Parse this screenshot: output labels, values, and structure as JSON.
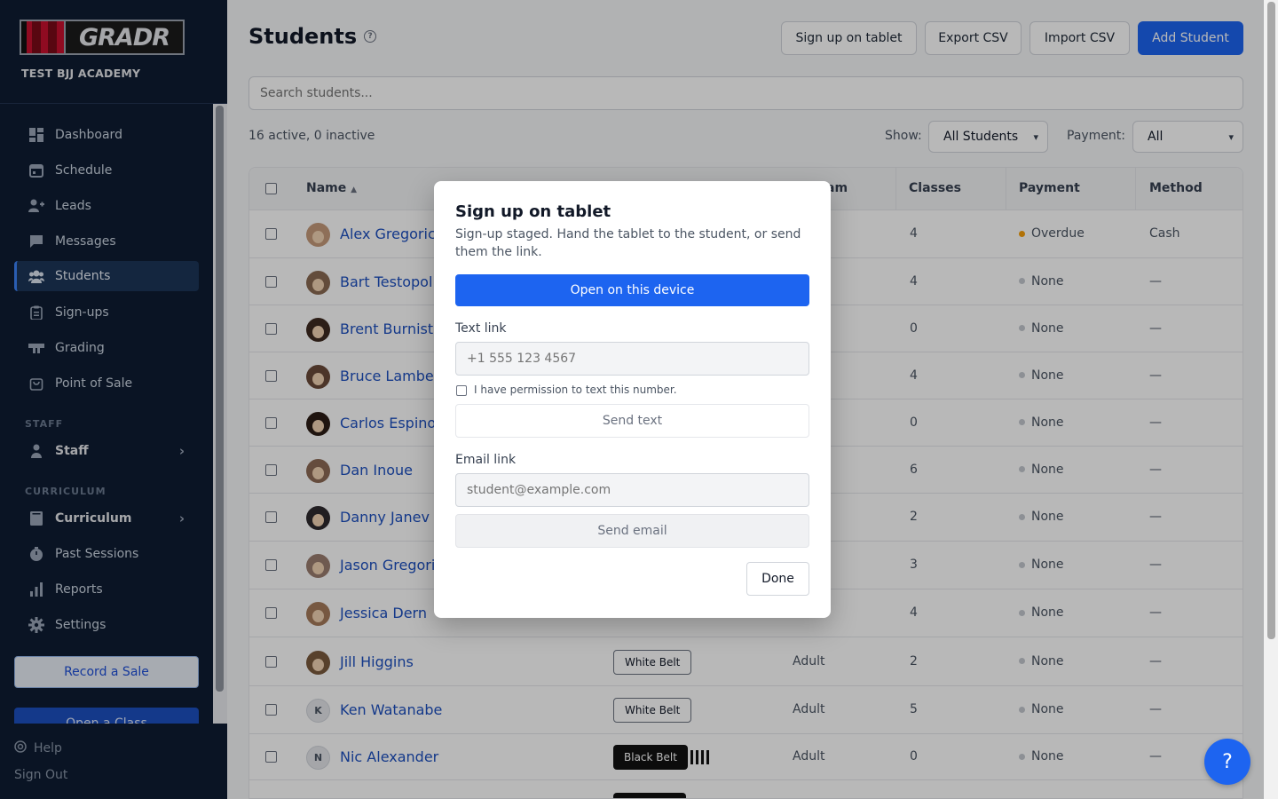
{
  "sidebar": {
    "logo_text": "GRADR",
    "academy": "TEST BJJ ACADEMY",
    "nav": [
      {
        "label": "Dashboard",
        "icon": "dashboard-icon"
      },
      {
        "label": "Schedule",
        "icon": "calendar-icon"
      },
      {
        "label": "Leads",
        "icon": "user-plus-icon"
      },
      {
        "label": "Messages",
        "icon": "chat-icon"
      },
      {
        "label": "Students",
        "icon": "users-icon",
        "active": true
      },
      {
        "label": "Sign-ups",
        "icon": "clipboard-icon"
      },
      {
        "label": "Grading",
        "icon": "belt-icon"
      },
      {
        "label": "Point of Sale",
        "icon": "shopping-bag-icon"
      }
    ],
    "staff_section": "STAFF",
    "staff_item": "Staff",
    "curriculum_section": "CURRICULUM",
    "curriculum_item": "Curriculum",
    "nav2": [
      {
        "label": "Past Sessions",
        "icon": "clock-icon"
      },
      {
        "label": "Reports",
        "icon": "bar-chart-icon"
      },
      {
        "label": "Settings",
        "icon": "gear-icon"
      }
    ],
    "record_sale": "Record a Sale",
    "open_class": "Open a Class",
    "help": "Help",
    "sign_out": "Sign Out"
  },
  "header": {
    "title": "Students",
    "buttons": {
      "signup_tablet": "Sign up on tablet",
      "export_csv": "Export CSV",
      "import_csv": "Import CSV",
      "add_student": "Add Student"
    }
  },
  "search": {
    "placeholder": "Search students..."
  },
  "filters": {
    "counts": "16 active, 0 inactive",
    "show_label": "Show:",
    "show_value": "All Students",
    "payment_label": "Payment:",
    "payment_value": "All"
  },
  "table": {
    "columns": {
      "name": "Name",
      "sort_indicator": "▲",
      "program_fragment": "am",
      "classes": "Classes",
      "payment": "Payment",
      "method": "Method"
    },
    "rows": [
      {
        "name": "Alex Gregoric",
        "belt": "",
        "stripes": 0,
        "program": "",
        "classes": "4",
        "payment": "Overdue",
        "method": "Cash",
        "status": "overdue"
      },
      {
        "name": "Bart Testopol",
        "belt": "",
        "stripes": 0,
        "program": "",
        "classes": "4",
        "payment": "None",
        "method": "—"
      },
      {
        "name": "Brent Burniste",
        "belt": "",
        "stripes": 0,
        "program": "",
        "classes": "0",
        "payment": "None",
        "method": "—"
      },
      {
        "name": "Bruce Lambe",
        "belt": "",
        "stripes": 0,
        "program": "",
        "classes": "4",
        "payment": "None",
        "method": "—"
      },
      {
        "name": "Carlos Espino",
        "belt": "",
        "stripes": 0,
        "program": "",
        "classes": "0",
        "payment": "None",
        "method": "—"
      },
      {
        "name": "Dan Inoue",
        "belt": "",
        "stripes": 0,
        "program": "",
        "classes": "6",
        "payment": "None",
        "method": "—"
      },
      {
        "name": "Danny Janev",
        "belt": "",
        "stripes": 0,
        "program": "",
        "classes": "2",
        "payment": "None",
        "method": "—"
      },
      {
        "name": "Jason Gregori",
        "belt": "",
        "stripes": 0,
        "program": "",
        "classes": "3",
        "payment": "None",
        "method": "—"
      },
      {
        "name": "Jessica Dern",
        "belt": "",
        "stripes": 0,
        "program": "",
        "classes": "4",
        "payment": "None",
        "method": "—"
      },
      {
        "name": "Jill Higgins",
        "belt": "White Belt",
        "belt_color": "white",
        "stripes": 0,
        "program": "Adult",
        "classes": "2",
        "payment": "None",
        "method": "—"
      },
      {
        "name": "Ken Watanabe",
        "initial": "K",
        "belt": "White Belt",
        "belt_color": "white",
        "stripes": 0,
        "program": "Adult",
        "classes": "5",
        "payment": "None",
        "method": "—"
      },
      {
        "name": "Nic Alexander",
        "initial": "N",
        "belt": "Black Belt",
        "belt_color": "black",
        "stripes": 4,
        "program": "Adult",
        "classes": "0",
        "payment": "None",
        "method": "—"
      }
    ]
  },
  "modal": {
    "title": "Sign up on tablet",
    "subtitle": "Sign-up staged. Hand the tablet to the student, or send them the link.",
    "open_device": "Open on this device",
    "text_link_label": "Text link",
    "phone_placeholder": "+1 555 123 4567",
    "permission_label": "I have permission to text this number.",
    "send_text": "Send text",
    "email_link_label": "Email link",
    "email_placeholder": "student@example.com",
    "send_email": "Send email",
    "done": "Done"
  },
  "fab": {
    "label": "?"
  },
  "colors": {
    "sidebar_bg": "#0f1d33",
    "primary": "#1d64f0",
    "link": "#1d4fbf",
    "overdue": "#f59e0b"
  }
}
